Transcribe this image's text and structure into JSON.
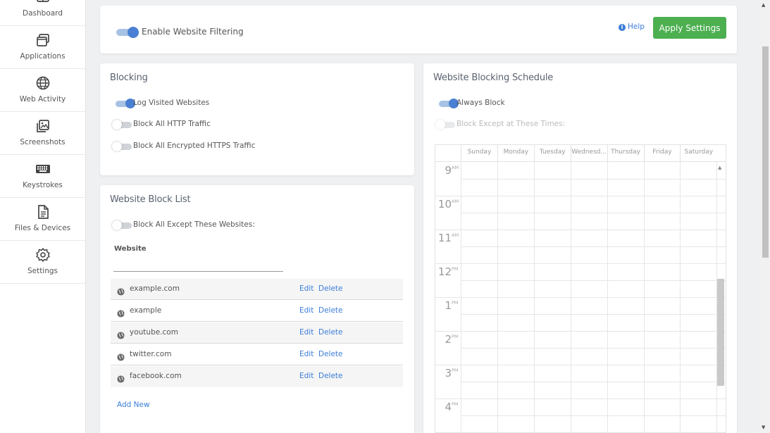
{
  "sidebar": {
    "items": [
      {
        "label": "Dashboard",
        "icon": "dashboard-icon"
      },
      {
        "label": "Applications",
        "icon": "applications-icon"
      },
      {
        "label": "Web Activity",
        "icon": "globe-icon"
      },
      {
        "label": "Screenshots",
        "icon": "screenshots-icon"
      },
      {
        "label": "Keystrokes",
        "icon": "keyboard-icon"
      },
      {
        "label": "Files & Devices",
        "icon": "file-icon"
      },
      {
        "label": "Settings",
        "icon": "gear-icon"
      }
    ]
  },
  "header": {
    "enable_filtering_label": "Enable Website Filtering",
    "enable_filtering_on": true,
    "help_label": "Help",
    "apply_label": "Apply Settings"
  },
  "blocking": {
    "title": "Blocking",
    "options": [
      {
        "label": "Log Visited Websites",
        "on": true
      },
      {
        "label": "Block All HTTP Traffic",
        "on": false
      },
      {
        "label": "Block All Encrypted HTTPS Traffic",
        "on": false
      }
    ]
  },
  "block_list": {
    "title": "Website Block List",
    "except_label": "Block All Except These Websites:",
    "except_on": false,
    "column_header": "Website",
    "input_value": "",
    "edit_label": "Edit",
    "delete_label": "Delete",
    "sites": [
      "example.com",
      "example",
      "youtube.com",
      "twitter.com",
      "facebook.com"
    ],
    "add_new_label": "Add New"
  },
  "schedule": {
    "title": "Website Blocking Schedule",
    "always_block_label": "Always Block",
    "always_block_on": true,
    "except_times_label": "Block Except at These Times:",
    "except_times_on": false,
    "days": [
      "Sunday",
      "Monday",
      "Tuesday",
      "Wednesd...",
      "Thursday",
      "Friday",
      "Saturday"
    ],
    "hours": [
      {
        "num": "9",
        "ampm": "AM"
      },
      {
        "num": "10",
        "ampm": "AM"
      },
      {
        "num": "11",
        "ampm": "AM"
      },
      {
        "num": "12",
        "ampm": "PM"
      },
      {
        "num": "1",
        "ampm": "PM"
      },
      {
        "num": "2",
        "ampm": "PM"
      },
      {
        "num": "3",
        "ampm": "PM"
      },
      {
        "num": "4",
        "ampm": "PM"
      }
    ]
  },
  "colors": {
    "accent": "#3b7dd8",
    "apply_button": "#4caf50",
    "toggle_on": "#4a80d3"
  }
}
